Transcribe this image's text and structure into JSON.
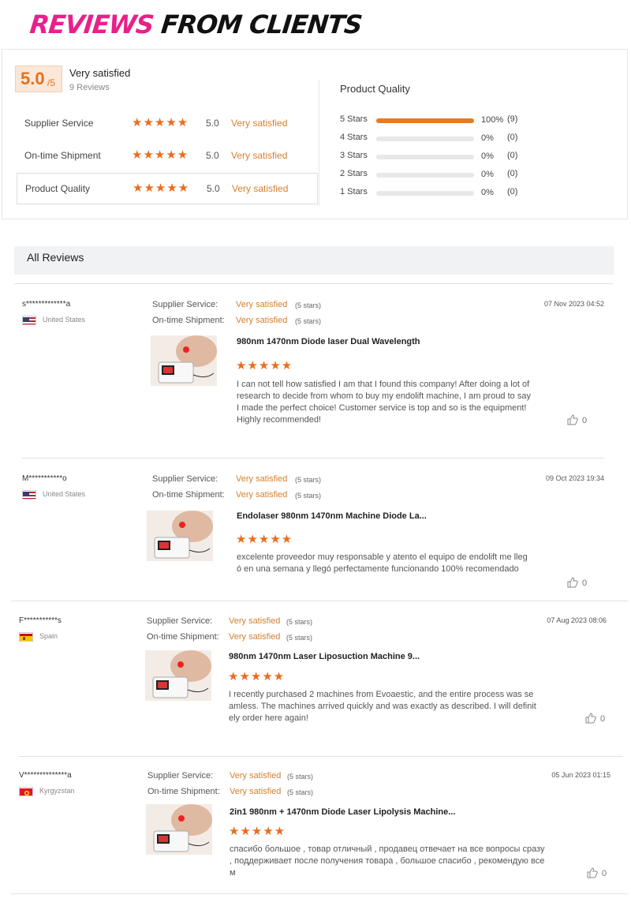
{
  "banner": {
    "part1": "REVIEWS",
    "part2": "FROM CLIENTS"
  },
  "summary": {
    "score": "5.0",
    "out_of": "/5",
    "title": "Very satisfied",
    "count": "9 Reviews",
    "ratings": [
      {
        "label": "Supplier Service",
        "score": "5.0",
        "word": "Very satisfied"
      },
      {
        "label": "On-time Shipment",
        "score": "5.0",
        "word": "Very satisfied"
      },
      {
        "label": "Product Quality",
        "score": "5.0",
        "word": "Very satisfied"
      }
    ],
    "product_quality_title": "Product Quality",
    "bars": [
      {
        "label": "5 Stars",
        "fraction": 1.0,
        "pct": "100%",
        "count": "(9)"
      },
      {
        "label": "4 Stars",
        "fraction": 0,
        "pct": "0%",
        "count": "(0)"
      },
      {
        "label": "3 Stars",
        "fraction": 0,
        "pct": "0%",
        "count": "(0)"
      },
      {
        "label": "2 Stars",
        "fraction": 0,
        "pct": "0%",
        "count": "(0)"
      },
      {
        "label": "1 Stars",
        "fraction": 0,
        "pct": "0%",
        "count": "(0)"
      }
    ]
  },
  "all_reviews_title": "All Reviews",
  "review_labels": {
    "supplier": "Supplier Service:",
    "shipment": "On-time Shipment:",
    "value": "Very satisfied",
    "stars": "(5 stars)"
  },
  "reviews": [
    {
      "user": "s*************a",
      "country": "United States",
      "date": "07 Nov 2023 04:52",
      "product": "980nm 1470nm Diode laser Dual Wavelength",
      "text": "I can not tell how satisfied I am that I found this company! After doing a lot of research to decide from whom to buy my endolift machine, I am proud to say I made the perfect choice! Customer service is top and so is the equipment! Highly recommended!",
      "likes": "0"
    },
    {
      "user": "M***********o",
      "country": "United States",
      "date": "09 Oct 2023 19:34",
      "product": "Endolaser 980nm 1470nm Machine Diode La...",
      "text": "excelente proveedor muy responsable y atento el equipo de endolift me llegó en una semana y llegó perfectamente funcionando 100% recomendado",
      "likes": "0"
    },
    {
      "user": "F***********s",
      "country": "Spain",
      "date": "07 Aug 2023 08:06",
      "product": "980nm 1470nm Laser Liposuction Machine 9...",
      "text": "I recently purchased 2 machines from Evoaestic, and the entire process was seamless. The machines arrived quickly and was exactly as described. I will definitely order here again!",
      "likes": "0"
    },
    {
      "user": "V**************a",
      "country": "Kyrgyzstan",
      "date": "05 Jun 2023 01:15",
      "product": "2in1 980nm + 1470nm Diode Laser Lipolysis Machine...",
      "text": "спасибо большое , товар отличный , продавец отвечает на все вопросы сразу , поддерживает после получения товара , большое спасибо , рекомендую всем",
      "likes": "0"
    }
  ],
  "colors": {
    "accent": "#e67c22",
    "banner_pink": "#e8208a"
  }
}
